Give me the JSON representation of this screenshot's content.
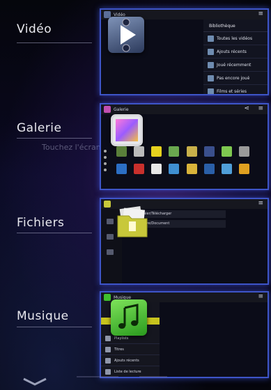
{
  "sections": [
    {
      "label": "Vidéo",
      "panel_title": "Vidéo",
      "list_header": "Bibliothèque",
      "items": [
        "Toutes les vidéos",
        "Ajouts récents",
        "Joué récemment",
        "Pas encore joué",
        "Films et séries"
      ]
    },
    {
      "label": "Galerie",
      "panel_title": "Galerie"
    },
    {
      "label": "Fichiers",
      "rows": [
        "Dossier/Télécharger",
        "Archive/Document"
      ]
    },
    {
      "label": "Musique",
      "panel_title": "Musique",
      "items": [
        "Playlists",
        "Titres",
        "Ajouts récents",
        "Liste de lecture"
      ]
    }
  ],
  "background_hint": "Touchez l'écran",
  "colors": {
    "panel_border": "#3e55c8",
    "music_icon": "#3fbf2e",
    "files_icon": "#c8c83a",
    "video_icon": "#5b6f99"
  },
  "icons": {
    "video": "play-icon",
    "gallery": "image-icon",
    "files": "folder-icon",
    "music": "music-note-icon",
    "bottom_nav": "chevron-down-icon"
  }
}
